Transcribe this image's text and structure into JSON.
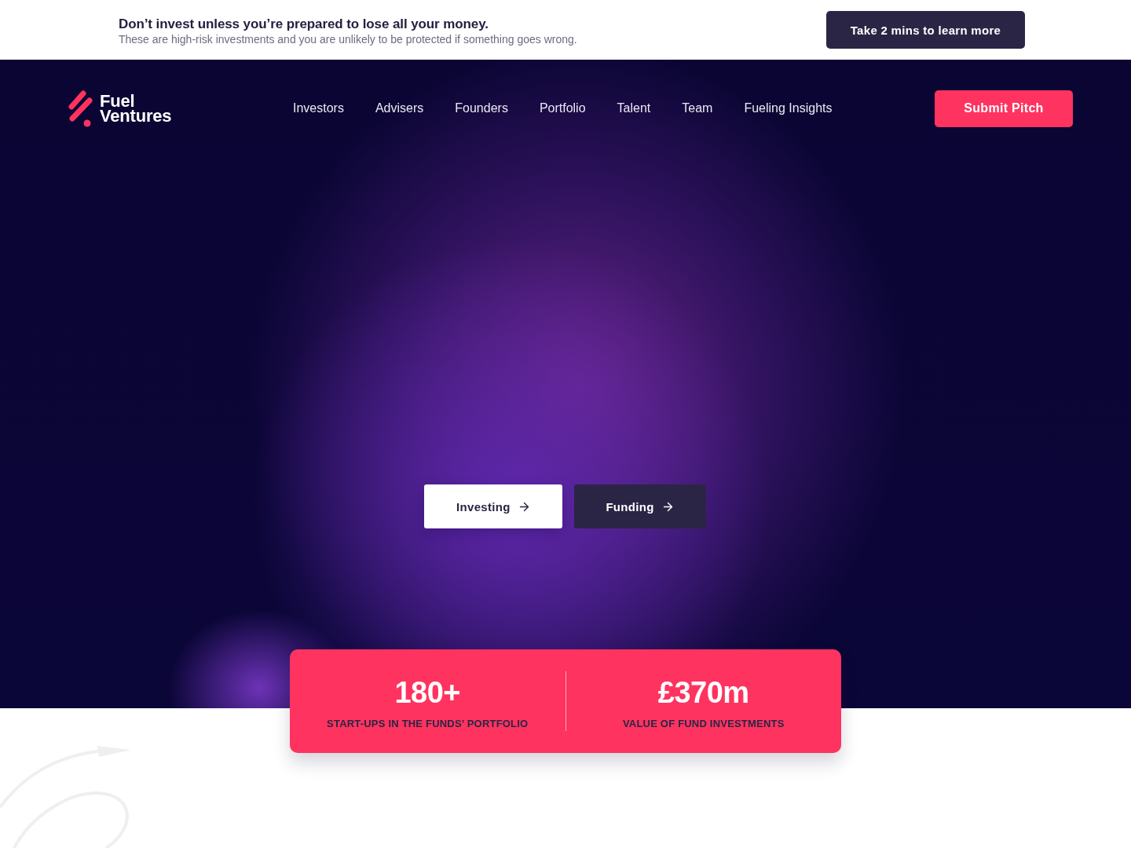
{
  "risk_banner": {
    "heading": "Don’t invest unless you’re prepared to lose all your money.",
    "text": "These are high-risk investments and you are unlikely to be protected if something goes wrong.",
    "button": "Take 2 mins to learn more"
  },
  "navbar": {
    "logo": {
      "text_lines": [
        "Fuel",
        "Ventures"
      ]
    },
    "items": [
      "Investors",
      "Advisers",
      "Founders",
      "Portfolio",
      "Talent",
      "Team",
      "Fueling Insights"
    ],
    "cta": "Submit Pitch"
  },
  "hero": {
    "buttons": [
      {
        "label": "Investing",
        "kind": "light"
      },
      {
        "label": "Funding",
        "kind": "dark"
      }
    ]
  },
  "stats": [
    {
      "value": "180+",
      "label": "START-UPS IN THE FUNDS’ PORTFOLIO"
    },
    {
      "value": "£370m",
      "label": "VALUE OF FUND INVESTMENTS"
    }
  ]
}
